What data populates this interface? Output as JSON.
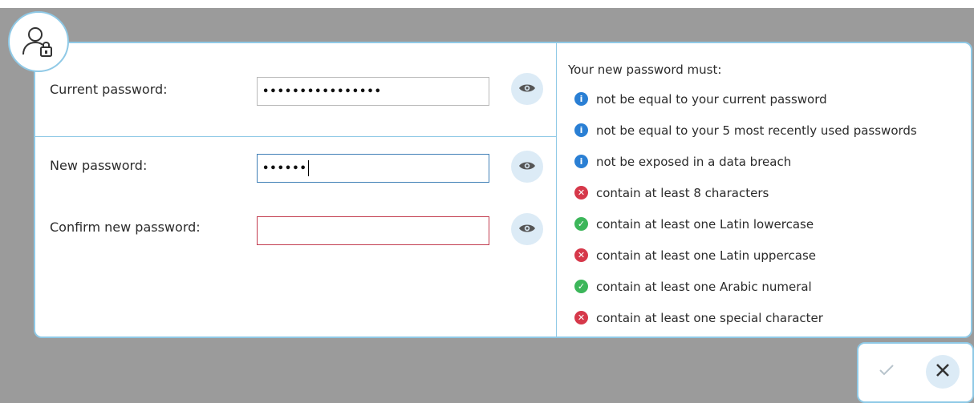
{
  "current": {
    "label": "Current password:",
    "masked": "••••••••••••••••"
  },
  "new_pw": {
    "label": "New password:",
    "masked": "••••••"
  },
  "confirm": {
    "label": "Confirm new password:",
    "masked": ""
  },
  "requirements": {
    "title": "Your new password must:",
    "items": [
      {
        "text": "not be equal to your current password",
        "status": "info"
      },
      {
        "text": "not be equal to your 5 most recently used passwords",
        "status": "info"
      },
      {
        "text": "not be exposed in a data breach",
        "status": "info"
      },
      {
        "text": "contain at least 8 characters",
        "status": "fail"
      },
      {
        "text": "contain at least one Latin lowercase",
        "status": "ok"
      },
      {
        "text": "contain at least one Latin uppercase",
        "status": "fail"
      },
      {
        "text": "contain at least one Arabic numeral",
        "status": "ok"
      },
      {
        "text": "contain at least one special character",
        "status": "fail"
      }
    ]
  },
  "colors": {
    "accent": "#8fc9e6",
    "info": "#2a7fd4",
    "fail": "#d6384a",
    "ok": "#3cb65a",
    "error_border": "#c23b4e"
  },
  "icons": {
    "avatar": "user-lock-icon",
    "show_password": "eye-icon",
    "confirm": "check-icon",
    "cancel": "close-icon"
  }
}
